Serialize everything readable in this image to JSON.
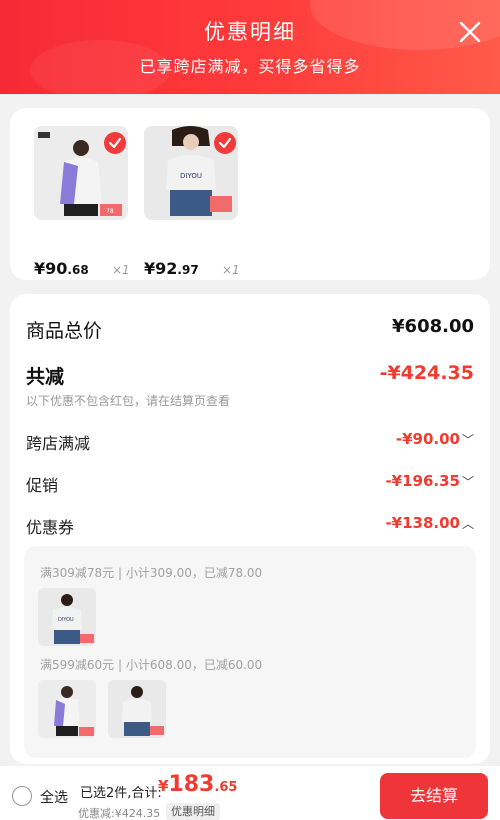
{
  "header": {
    "title": "优惠明细",
    "subtitle": "已享跨店满减，买得多省得多"
  },
  "products": [
    {
      "price_int": "¥90",
      "price_dec": ".68",
      "qty": "×1",
      "tag": "78"
    },
    {
      "price_int": "¥92",
      "price_dec": ".97",
      "qty": "×1",
      "tag": ""
    }
  ],
  "summary": {
    "goods_total_label": "商品总价",
    "goods_total_value": "¥608.00",
    "total_reduce_label": "共减",
    "total_reduce_value": "-¥424.35",
    "note": "以下优惠不包含红包，请在结算页查看",
    "rows": [
      {
        "label": "跨店满减",
        "value": "-¥90.00"
      },
      {
        "label": "促销",
        "value": "-¥196.35"
      },
      {
        "label": "优惠券",
        "value": "-¥138.00"
      }
    ]
  },
  "coupon_details": [
    {
      "text": "满309减78元 | 小计309.00，已减78.00"
    },
    {
      "text": "满599减60元 | 小计608.00，已减60.00"
    }
  ],
  "bottom": {
    "select_all": "全选",
    "selected_summary": "已选2件,合计:",
    "total_currency": "¥",
    "total_int": "183",
    "total_dec": ".65",
    "discount_text": "优惠减:¥424.35",
    "detail_label": "优惠明细",
    "checkout_label": "去结算"
  },
  "colors": {
    "brand_red": "#f0353a",
    "price_red": "#f03b2e"
  }
}
